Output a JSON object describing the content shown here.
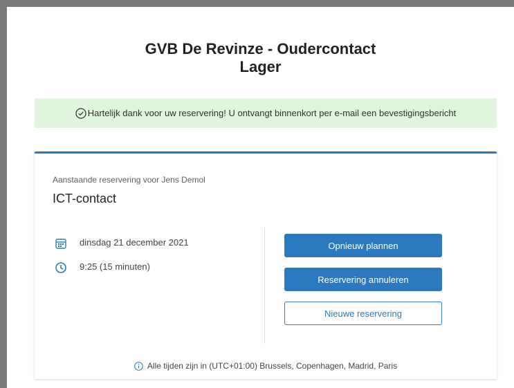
{
  "page": {
    "title_line1": "GVB De Revinze - Oudercontact",
    "title_line2": "Lager"
  },
  "banner": {
    "message": "Hartelijk dank voor uw reservering! U ontvangt binnenkort per e-mail een bevestigingsbericht",
    "icon": "check-circle-icon"
  },
  "booking": {
    "upcoming_label": "Aanstaande reservering voor Jens Demol",
    "service": "ICT-contact",
    "date": "dinsdag 21 december 2021",
    "time": "9:25 (15 minuten)"
  },
  "actions": {
    "reschedule": "Opnieuw plannen",
    "cancel": "Reservering annuleren",
    "new": "Nieuwe reservering"
  },
  "footer": {
    "timezone": "Alle tijden zijn in (UTC+01:00) Brussels, Copenhagen, Madrid, Paris"
  },
  "colors": {
    "accent": "#2b79bf",
    "banner_bg": "#dff6dd"
  }
}
